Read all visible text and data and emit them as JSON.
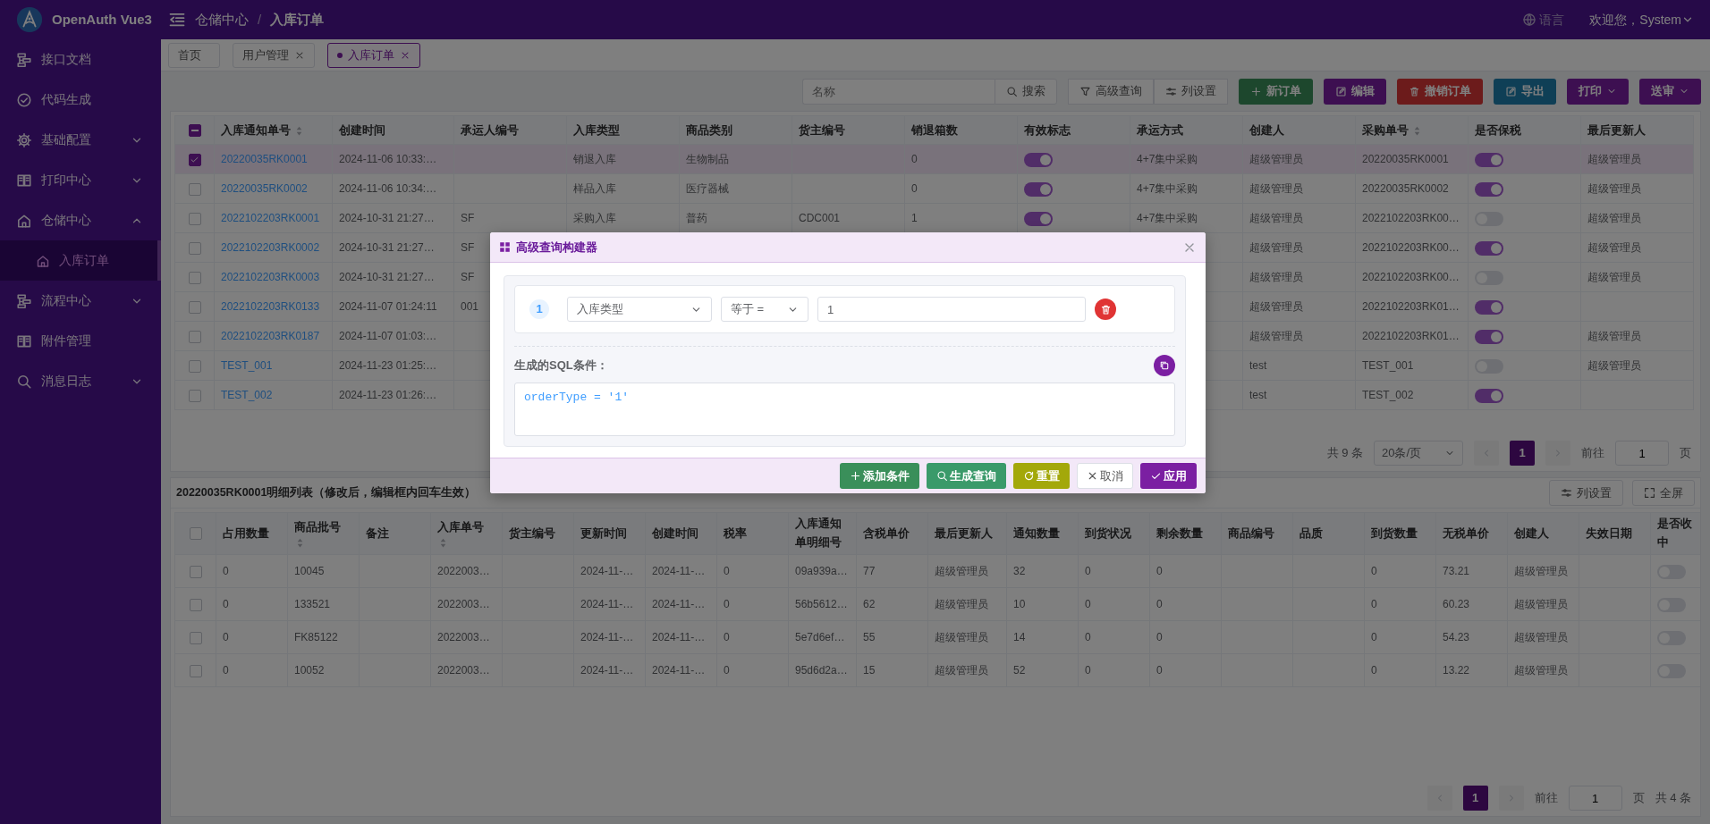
{
  "header": {
    "app_name": "OpenAuth Vue3",
    "breadcrumb": [
      "仓储中心",
      "入库订单"
    ],
    "breadcrumb_separator": "/",
    "language": "语言",
    "user": "欢迎您，System"
  },
  "sidebar": {
    "items": [
      {
        "label": "接口文档",
        "kind": "link",
        "selected": false
      },
      {
        "label": "代码生成",
        "kind": "link",
        "selected": false
      },
      {
        "label": "基础配置",
        "kind": "group",
        "expanded": false,
        "selected": false
      },
      {
        "label": "打印中心",
        "kind": "group",
        "expanded": false,
        "selected": false
      },
      {
        "label": "仓储中心",
        "kind": "group",
        "expanded": true,
        "selected": false,
        "children": [
          {
            "label": "入库订单",
            "selected": true
          }
        ]
      },
      {
        "label": "流程中心",
        "kind": "group",
        "expanded": false,
        "selected": false
      },
      {
        "label": "附件管理",
        "kind": "link",
        "selected": false
      },
      {
        "label": "消息日志",
        "kind": "group",
        "expanded": false,
        "selected": false
      }
    ]
  },
  "tabs": [
    {
      "label": "首页",
      "closable": false,
      "selected": false
    },
    {
      "label": "用户管理",
      "closable": true,
      "selected": false
    },
    {
      "label": "入库订单",
      "closable": true,
      "selected": true
    }
  ],
  "toolbar": {
    "search": {
      "placeholder": "名称"
    },
    "buttons": [
      {
        "label": "搜索",
        "kind": "search"
      },
      {
        "label": "高级查询",
        "kind": "filter"
      },
      {
        "label": "列设置",
        "kind": "columns"
      },
      {
        "label": "新订单",
        "kind": "add"
      },
      {
        "label": "编辑",
        "kind": "edit"
      },
      {
        "label": "撤销订单",
        "kind": "delete"
      },
      {
        "label": "导出",
        "kind": "export"
      },
      {
        "label": "打印",
        "kind": "menu"
      },
      {
        "label": "送审",
        "kind": "menu"
      }
    ]
  },
  "table": {
    "header_checkbox": {
      "partial": true
    },
    "columns": [
      {
        "label": "入库通知单号",
        "kind": "link",
        "sortable": true
      },
      {
        "label": "创建时间",
        "sortable": false
      },
      {
        "label": "承运人编号",
        "sortable": false
      },
      {
        "label": "入库类型",
        "sortable": false
      },
      {
        "label": "商品类别",
        "sortable": false
      },
      {
        "label": "货主编号",
        "sortable": false
      },
      {
        "label": "销退箱数",
        "sortable": false
      },
      {
        "label": "有效标志",
        "kind": "switch",
        "sortable": false
      },
      {
        "label": "承运方式",
        "sortable": false
      },
      {
        "label": "创建人",
        "sortable": false
      },
      {
        "label": "采购单号",
        "sortable": true
      },
      {
        "label": "是否保税",
        "kind": "switch",
        "sortable": false
      },
      {
        "label": "最后更新人",
        "sortable": false
      }
    ],
    "rows": [
      {
        "selected": true,
        "cells": [
          "20220035RK0001",
          "2024-11-06 10:33:…",
          null,
          "销退入库",
          "生物制品",
          null,
          "0",
          {
            "on": true
          },
          "4+7集中采购",
          "超级管理员",
          "20220035RK0001",
          {
            "on": true
          },
          "超级管理员"
        ]
      },
      {
        "selected": false,
        "cells": [
          "20220035RK0002",
          "2024-11-06 10:34:…",
          null,
          "样品入库",
          "医疗器械",
          null,
          "0",
          {
            "on": true
          },
          "4+7集中采购",
          "超级管理员",
          "20220035RK0002",
          {
            "on": true
          },
          "超级管理员"
        ]
      },
      {
        "selected": false,
        "cells": [
          "2022102203RK0001",
          "2024-10-31 21:27…",
          "SF",
          "采购入库",
          "普药",
          "CDC001",
          "1",
          {
            "on": true
          },
          "4+7集中采购",
          "超级管理员",
          "2022102203RK00…",
          {
            "on": false
          },
          "超级管理员"
        ]
      },
      {
        "selected": false,
        "cells": [
          "2022102203RK0002",
          "2024-10-31 21:27…",
          "SF",
          null,
          null,
          null,
          null,
          null,
          null,
          "超级管理员",
          "2022102203RK00…",
          {
            "on": true
          },
          "超级管理员"
        ]
      },
      {
        "selected": false,
        "cells": [
          "2022102203RK0003",
          "2024-10-31 21:27…",
          "SF",
          null,
          null,
          null,
          null,
          null,
          null,
          "超级管理员",
          "2022102203RK00…",
          {
            "on": false
          },
          "超级管理员"
        ]
      },
      {
        "selected": false,
        "cells": [
          "2022102203RK0133",
          "2024-11-07 01:24:11",
          "001",
          null,
          null,
          null,
          null,
          null,
          null,
          "超级管理员",
          "2022102203RK01…",
          {
            "on": true
          },
          null
        ]
      },
      {
        "selected": false,
        "cells": [
          "2022102203RK0187",
          "2024-11-07 01:03:…",
          null,
          null,
          null,
          null,
          null,
          null,
          null,
          "超级管理员",
          "2022102203RK01…",
          {
            "on": true
          },
          "超级管理员"
        ]
      },
      {
        "selected": false,
        "cells": [
          "TEST_001",
          "2024-11-23 01:25:…",
          null,
          null,
          null,
          null,
          null,
          null,
          null,
          "test",
          "TEST_001",
          {
            "on": false
          },
          "超级管理员"
        ]
      },
      {
        "selected": false,
        "cells": [
          "TEST_002",
          "2024-11-23 01:26:…",
          null,
          null,
          null,
          null,
          null,
          null,
          null,
          "test",
          "TEST_002",
          {
            "on": true
          },
          null
        ]
      }
    ]
  },
  "pagination": {
    "parts": [
      {
        "kind": "total",
        "text": "共 9 条"
      },
      {
        "kind": "size",
        "text": "20条/页"
      },
      {
        "kind": "pager",
        "pages": [
          {
            "label": "1",
            "selected": true
          }
        ]
      },
      {
        "kind": "goto",
        "label": "前往",
        "value": "1",
        "unit": "页"
      }
    ]
  },
  "detail": {
    "title": "20220035RK0001明细列表（修改后，编辑框内回车生效）",
    "buttons": [
      {
        "label": "列设置",
        "kind": "columns"
      },
      {
        "label": "全屏",
        "kind": "fullscreen"
      }
    ],
    "table": {
      "header_checkbox": {
        "partial": false
      },
      "columns": [
        {
          "label": "占用数量",
          "sortable": false
        },
        {
          "label": "商品批号",
          "sortable": true
        },
        {
          "label": "备注",
          "sortable": false
        },
        {
          "label": "入库单号",
          "sortable": true
        },
        {
          "label": "货主编号",
          "sortable": false
        },
        {
          "label": "更新时间",
          "sortable": false
        },
        {
          "label": "创建时间",
          "sortable": false
        },
        {
          "label": "税率",
          "sortable": false
        },
        {
          "label": "入库通知单明细号",
          "sortable": false
        },
        {
          "label": "含税单价",
          "sortable": false
        },
        {
          "label": "最后更新人",
          "sortable": false
        },
        {
          "label": "通知数量",
          "sortable": false
        },
        {
          "label": "到货状况",
          "sortable": false
        },
        {
          "label": "剩余数量",
          "sortable": false
        },
        {
          "label": "商品编号",
          "sortable": false
        },
        {
          "label": "品质",
          "sortable": false
        },
        {
          "label": "到货数量",
          "sortable": false
        },
        {
          "label": "无税单价",
          "sortable": false
        },
        {
          "label": "创建人",
          "sortable": false
        },
        {
          "label": "失效日期",
          "sortable": false
        },
        {
          "label": "是否收中",
          "kind": "switch",
          "sortable": false
        }
      ],
      "rows": [
        {
          "selected": false,
          "cells": [
            "0",
            "10045",
            null,
            "2022003…",
            null,
            "2024-11-…",
            "2024-11-…",
            "0",
            "09a939a…",
            "77",
            "超级管理员",
            "32",
            "0",
            "0",
            null,
            null,
            "0",
            "73.21",
            "超级管理员",
            null,
            {
              "on": false
            }
          ]
        },
        {
          "selected": false,
          "cells": [
            "0",
            "133521",
            null,
            "2022003…",
            null,
            "2024-11-…",
            "2024-11-…",
            "0",
            "56b5612…",
            "62",
            "超级管理员",
            "10",
            "0",
            "0",
            null,
            null,
            "0",
            "60.23",
            "超级管理员",
            null,
            {
              "on": false
            }
          ]
        },
        {
          "selected": false,
          "cells": [
            "0",
            "FK85122",
            null,
            "2022003…",
            null,
            "2024-11-…",
            "2024-11-…",
            "0",
            "5e7d6ef…",
            "55",
            "超级管理员",
            "14",
            "0",
            "0",
            null,
            null,
            "0",
            "54.23",
            "超级管理员",
            null,
            {
              "on": false
            }
          ]
        },
        {
          "selected": false,
          "cells": [
            "0",
            "10052",
            null,
            "2022003…",
            null,
            "2024-11-…",
            "2024-11-…",
            "0",
            "95d6d2a…",
            "15",
            "超级管理员",
            "52",
            "0",
            "0",
            null,
            null,
            "0",
            "13.22",
            "超级管理员",
            null,
            {
              "on": false
            }
          ]
        }
      ]
    },
    "pagination": {
      "parts": [
        {
          "kind": "pager",
          "pages": [
            {
              "label": "1",
              "selected": true
            }
          ]
        },
        {
          "kind": "goto",
          "label": "前往",
          "value": "1",
          "unit": "页"
        },
        {
          "kind": "total",
          "text": "共 4 条"
        }
      ]
    }
  },
  "modal": {
    "title": "高级查询构建器",
    "conditions": [
      {
        "index": "1",
        "field": "入库类型",
        "operator": "等于 =",
        "value": "1"
      }
    ],
    "sql_label": "生成的SQL条件：",
    "sql": "orderType = '1'",
    "buttons": [
      {
        "label": "添加条件",
        "kind": "add"
      },
      {
        "label": "生成查询",
        "kind": "search"
      },
      {
        "label": "重置",
        "kind": "reset"
      },
      {
        "label": "取消",
        "kind": "cancel"
      },
      {
        "label": "应用",
        "kind": "apply"
      }
    ]
  }
}
